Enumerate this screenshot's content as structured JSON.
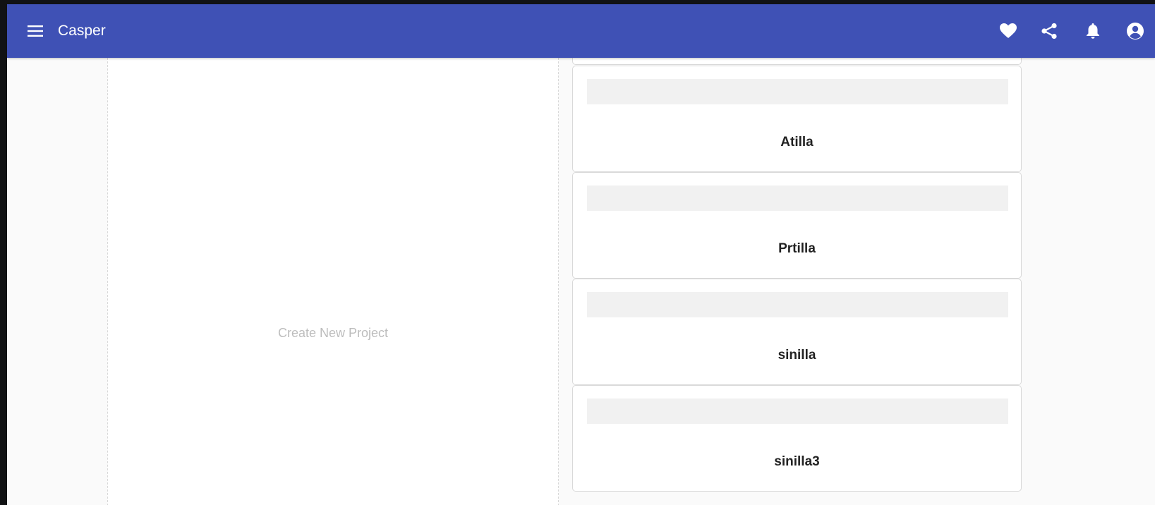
{
  "app": {
    "title": "Casper"
  },
  "toolbar": {
    "icons": [
      "menu-icon",
      "heart-icon",
      "share-icon",
      "bell-icon",
      "account-icon"
    ],
    "accent_color": "#3f51b5"
  },
  "create_panel": {
    "label": "Create New Project"
  },
  "projects": [
    {
      "name": "Atilla"
    },
    {
      "name": "Prtilla"
    },
    {
      "name": "sinilla"
    },
    {
      "name": "sinilla3"
    }
  ]
}
